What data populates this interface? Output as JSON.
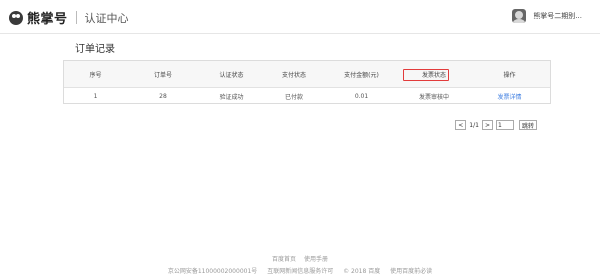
{
  "header": {
    "brand": "熊掌号",
    "center_title": "认证中心",
    "user_name": "熊掌号二期别..."
  },
  "page": {
    "title": "订单记录"
  },
  "table": {
    "columns": [
      "序号",
      "订单号",
      "认证状态",
      "支付状态",
      "支付金额(元)",
      "发票状态",
      "操作"
    ],
    "rows": [
      {
        "index": "1",
        "order_no": "28",
        "auth_status": "验证成功",
        "pay_status": "已付款",
        "amount": "0.01",
        "invoice_status": "发票审核中",
        "action": "发票详情"
      }
    ]
  },
  "pagination": {
    "prev": "<",
    "page_info": "1/1",
    "next": ">",
    "jump_value": "1",
    "go_label": "跳转"
  },
  "footer": {
    "links": [
      "百度首页",
      "使用手册"
    ],
    "bottom": [
      "京公网安备11000002000001号",
      "互联网新闻信息服务许可",
      "© 2018 百度",
      "使用百度前必读"
    ]
  },
  "colors": {
    "highlight": "#e23b3b",
    "link": "#3a7be0"
  }
}
